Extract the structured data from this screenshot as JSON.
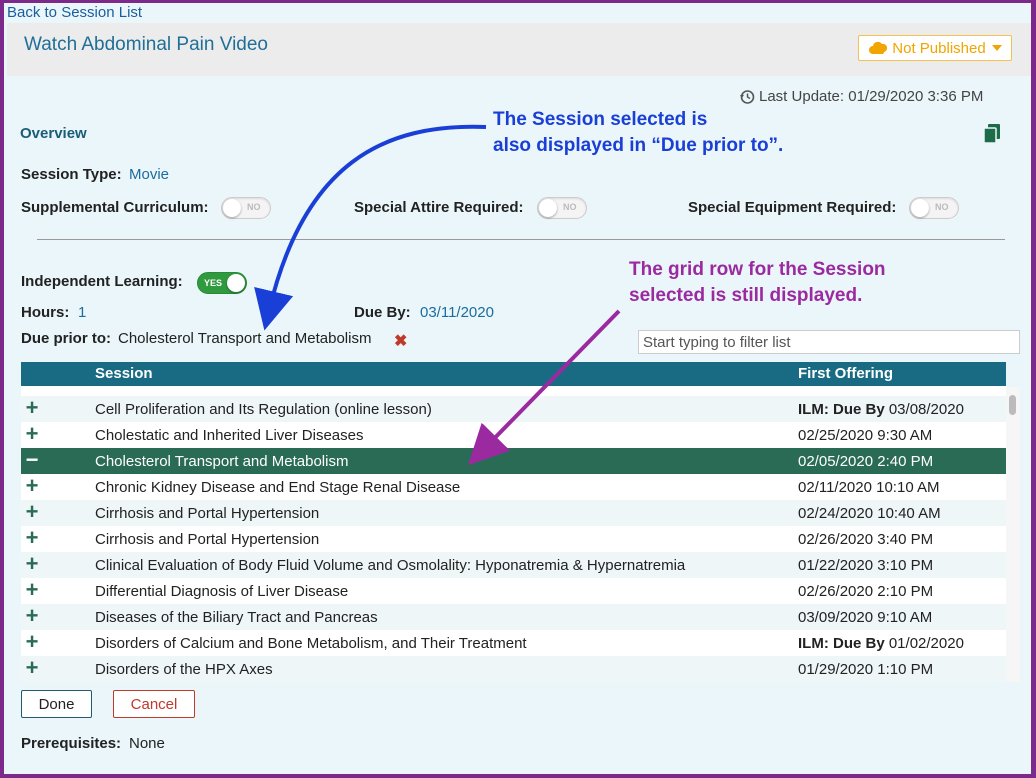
{
  "nav": {
    "back_label": "Back to Session List"
  },
  "header": {
    "title": "Watch Abdominal Pain Video",
    "status_label": "Not Published",
    "status_color": "#f0a500"
  },
  "meta": {
    "last_update": "Last Update: 01/29/2020 3:36 PM"
  },
  "overview": {
    "label": "Overview"
  },
  "fields": {
    "session_type_label": "Session Type:",
    "session_type_value": "Movie",
    "supplemental_label": "Supplemental Curriculum:",
    "supplemental_toggle": "NO",
    "attire_label": "Special Attire Required:",
    "attire_toggle": "NO",
    "equipment_label": "Special Equipment Required:",
    "equipment_toggle": "NO",
    "independent_label": "Independent Learning:",
    "independent_toggle": "YES",
    "hours_label": "Hours:",
    "hours_value": "1",
    "due_by_label": "Due By:",
    "due_by_value": "03/11/2020",
    "due_prior_label": "Due prior to:",
    "due_prior_value": "Cholesterol Transport and Metabolism"
  },
  "filter": {
    "placeholder": "Start typing to filter list"
  },
  "grid": {
    "columns": [
      "Session",
      "First Offering"
    ],
    "rows": [
      {
        "toggle": "+",
        "session": "Cell Proliferation and Its Regulation (online lesson)",
        "offering_prefix": "ILM: Due By",
        "offering": "03/08/2020"
      },
      {
        "toggle": "+",
        "session": "Cholestatic and Inherited Liver Diseases",
        "offering_prefix": "",
        "offering": "02/25/2020 9:30 AM"
      },
      {
        "toggle": "−",
        "session": "Cholesterol Transport and Metabolism",
        "offering_prefix": "",
        "offering": "02/05/2020 2:40 PM"
      },
      {
        "toggle": "+",
        "session": "Chronic Kidney Disease and End Stage Renal Disease",
        "offering_prefix": "",
        "offering": "02/11/2020 10:10 AM"
      },
      {
        "toggle": "+",
        "session": "Cirrhosis and Portal Hypertension",
        "offering_prefix": "",
        "offering": "02/24/2020 10:40 AM"
      },
      {
        "toggle": "+",
        "session": "Cirrhosis and Portal Hypertension",
        "offering_prefix": "",
        "offering": "02/26/2020 3:40 PM"
      },
      {
        "toggle": "+",
        "session": "Clinical Evaluation of Body Fluid Volume and Osmolality: Hyponatremia & Hypernatremia",
        "offering_prefix": "",
        "offering": "01/22/2020 3:10 PM"
      },
      {
        "toggle": "+",
        "session": "Differential Diagnosis of Liver Disease",
        "offering_prefix": "",
        "offering": "02/26/2020 2:10 PM"
      },
      {
        "toggle": "+",
        "session": "Diseases of the Biliary Tract and Pancreas",
        "offering_prefix": "",
        "offering": "03/09/2020 9:10 AM"
      },
      {
        "toggle": "+",
        "session": "Disorders of Calcium and Bone Metabolism, and Their Treatment",
        "offering_prefix": "ILM: Due By",
        "offering": "01/02/2020"
      },
      {
        "toggle": "+",
        "session": "Disorders of the HPX Axes",
        "offering_prefix": "",
        "offering": "01/29/2020 1:10 PM"
      }
    ],
    "selected_row_color": "#2a6b55",
    "header_color": "#186b82"
  },
  "actions": {
    "done_label": "Done",
    "cancel_label": "Cancel"
  },
  "prerequisites": {
    "label": "Prerequisites:",
    "value": "None"
  },
  "annotations": {
    "blue_line1": "The Session selected is",
    "blue_line2": "also displayed in “Due prior to”.",
    "purple_line1": "The grid row for the Session",
    "purple_line2": "selected is still displayed.",
    "blue_color": "#1a3fd6",
    "purple_color": "#9b2aa0"
  }
}
